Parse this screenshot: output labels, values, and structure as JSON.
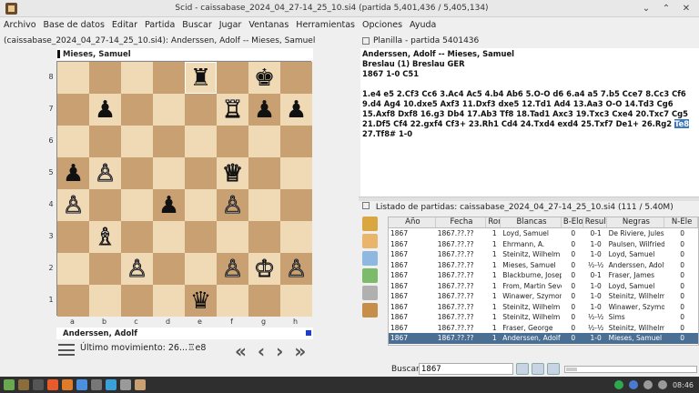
{
  "window": {
    "title": "Scid - caissabase_2024_04_27-14_25_10.si4 (partida 5,401,436 / 5,405,134)"
  },
  "menu": [
    "Archivo",
    "Base de datos",
    "Editar",
    "Partida",
    "Buscar",
    "Jugar",
    "Ventanas",
    "Herramientas",
    "Opciones",
    "Ayuda"
  ],
  "board_pane": {
    "title": "(caissabase_2024_04_27-14_25_10.si4): Anderssen, Adolf -- Mieses, Samuel"
  },
  "board": {
    "top_player": "Mieses, Samuel",
    "bottom_player": "Anderssen, Adolf",
    "ranks": [
      "8",
      "7",
      "6",
      "5",
      "4",
      "3",
      "2",
      "1"
    ],
    "files": [
      "a",
      "b",
      "c",
      "d",
      "e",
      "f",
      "g",
      "h"
    ],
    "pieces": [
      {
        "sq": "e8",
        "p": "♜",
        "c": "b"
      },
      {
        "sq": "g8",
        "p": "♚",
        "c": "b"
      },
      {
        "sq": "b7",
        "p": "♟",
        "c": "b"
      },
      {
        "sq": "f7",
        "p": "♖",
        "c": "w"
      },
      {
        "sq": "g7",
        "p": "♟",
        "c": "b"
      },
      {
        "sq": "h7",
        "p": "♟",
        "c": "b"
      },
      {
        "sq": "a5",
        "p": "♟",
        "c": "b"
      },
      {
        "sq": "b5",
        "p": "♙",
        "c": "w"
      },
      {
        "sq": "f5",
        "p": "♕",
        "c": "w"
      },
      {
        "sq": "a4",
        "p": "♙",
        "c": "w"
      },
      {
        "sq": "d4",
        "p": "♟",
        "c": "b"
      },
      {
        "sq": "f4",
        "p": "♙",
        "c": "w"
      },
      {
        "sq": "b3",
        "p": "♗",
        "c": "w"
      },
      {
        "sq": "c2",
        "p": "♙",
        "c": "w"
      },
      {
        "sq": "f2",
        "p": "♙",
        "c": "w"
      },
      {
        "sq": "g2",
        "p": "♔",
        "c": "w"
      },
      {
        "sq": "h2",
        "p": "♙",
        "c": "w"
      },
      {
        "sq": "e1",
        "p": "♛",
        "c": "b"
      }
    ],
    "last_move_label": "Último movimiento: 26...♖e8"
  },
  "planilla": {
    "title": "Planilla - partida 5401436",
    "header_line1": "Anderssen, Adolf  --  Mieses, Samuel",
    "header_line2": "Breslau (1)  Breslau GER",
    "header_line3": "1867  1-0  C51",
    "moves_before": "1.e4 e5 2.Cf3 Cc6 3.Ac4 Ac5 4.b4 Ab6 5.O-O d6 6.a4 a5 7.b5 Cce7 8.Cc3 Cf6 9.d4 Ag4 10.dxe5 Axf3 11.Dxf3 dxe5 12.Td1 Ad4 13.Aa3 O-O 14.Td3 Cg6 15.Axf8 Dxf8 16.g3 Db4 17.Ab3 Tf8 18.Tad1 Axc3 19.Txc3 Cxe4 20.Txc7 Cg5 21.Df5 Cf4 22.gxf4 Cf3+ 23.Rh1 Cd4 24.Txd4 exd4 25.Txf7 De1+ 26.Rg2 ",
    "moves_highlight": "Te8",
    "moves_after": " 27.Tf8# 1-0"
  },
  "game_list": {
    "title": "Listado de partidas: caissabase_2024_04_27-14_25_10.si4 (111 / 5.40M)",
    "columns": [
      "Año",
      "Fecha",
      "Ron",
      "Blancas",
      "B-Elo",
      "Resulta",
      "Negras",
      "N-Ele"
    ],
    "rows": [
      [
        "1867",
        "1867.??.??",
        "1",
        "Loyd, Samuel",
        "0",
        "0-1",
        "De Riviere, Jules",
        "0"
      ],
      [
        "1867",
        "1867.??.??",
        "1",
        "Ehrmann, A.",
        "0",
        "1-0",
        "Paulsen, Wilfried",
        "0"
      ],
      [
        "1867",
        "1867.??.??",
        "1",
        "Steinitz, Wilhelm",
        "0",
        "1-0",
        "Loyd, Samuel",
        "0"
      ],
      [
        "1867",
        "1867.??.??",
        "1",
        "Mieses, Samuel",
        "0",
        "½-½",
        "Anderssen, Adolf",
        "0"
      ],
      [
        "1867",
        "1867.??.??",
        "1",
        "Blackburne, Joseph",
        "0",
        "0-1",
        "Fraser, James",
        "0"
      ],
      [
        "1867",
        "1867.??.??",
        "1",
        "From, Martin Sever",
        "0",
        "1-0",
        "Loyd, Samuel",
        "0"
      ],
      [
        "1867",
        "1867.??.??",
        "1",
        "Winawer, Szymon",
        "0",
        "1-0",
        "Steinitz, Wilhelm",
        "0"
      ],
      [
        "1867",
        "1867.??.??",
        "1",
        "Steinitz, Wilhelm",
        "0",
        "1-0",
        "Winawer, Szymon",
        "0"
      ],
      [
        "1867",
        "1867.??.??",
        "1",
        "Steinitz, Wilhelm",
        "0",
        "½-½",
        "Sims",
        "0"
      ],
      [
        "1867",
        "1867.??.??",
        "1",
        "Fraser, George",
        "0",
        "½-½",
        "Steinitz, Wilhelm",
        "0"
      ],
      [
        "1867",
        "1867.??.??",
        "1",
        "Anderssen, Adolf",
        "0",
        "1-0",
        "Mieses, Samuel",
        "0"
      ]
    ],
    "selected_row": 10,
    "search_label": "Buscar",
    "search_value": "1867"
  },
  "taskbar": {
    "clock": "08:46"
  }
}
